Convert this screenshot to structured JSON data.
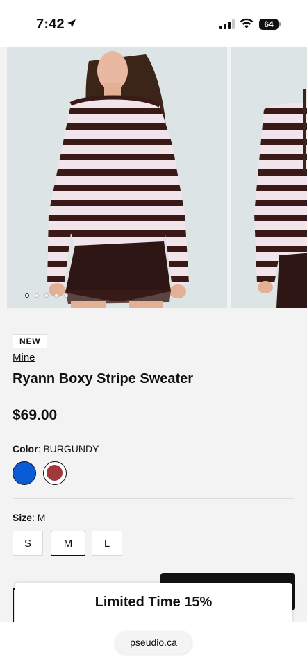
{
  "status_bar": {
    "time": "7:42",
    "battery": "64"
  },
  "gallery": {
    "dots": 5,
    "active_dot": 0
  },
  "product": {
    "badge": "NEW",
    "brand": "Mine",
    "title": "Ryann Boxy Stripe Sweater",
    "price": "$69.00",
    "color_label": "Color",
    "color_value": "BURGUNDY",
    "swatches": [
      {
        "name": "blue",
        "hex": "#0a5bd6"
      },
      {
        "name": "burgundy",
        "hex": "#a0383c",
        "selected": true
      }
    ],
    "size_label": "Size",
    "size_value": "M",
    "sizes": [
      "S",
      "M",
      "L"
    ]
  },
  "promo": {
    "text": "Limited Time 15%"
  },
  "browser": {
    "url": "pseudio.ca"
  }
}
